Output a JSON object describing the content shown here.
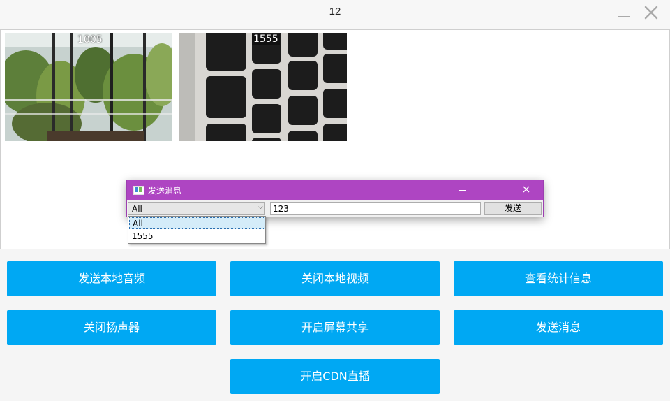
{
  "window": {
    "title": "12",
    "minimize_icon": "minimize-icon",
    "close_icon": "close-icon"
  },
  "videos": [
    {
      "label": "1005",
      "scene": "window-with-trees"
    },
    {
      "label": "1555",
      "scene": "keyboard-closeup"
    }
  ],
  "message_dialog": {
    "title": "发送消息",
    "icon": "app-icon",
    "target_selected": "All",
    "target_options": [
      "All",
      "1555"
    ],
    "message_value": "123",
    "send_label": "发送"
  },
  "actions": {
    "send_local_audio": "发送本地音频",
    "close_local_video": "关闭本地视频",
    "view_stats": "查看统计信息",
    "close_speaker": "关闭扬声器",
    "start_screen_share": "开启屏幕共享",
    "send_message": "发送消息",
    "start_cdn_live": "开启CDN直播"
  },
  "colors": {
    "accent": "#00a8f3",
    "dialog_titlebar": "#ae45c2"
  }
}
